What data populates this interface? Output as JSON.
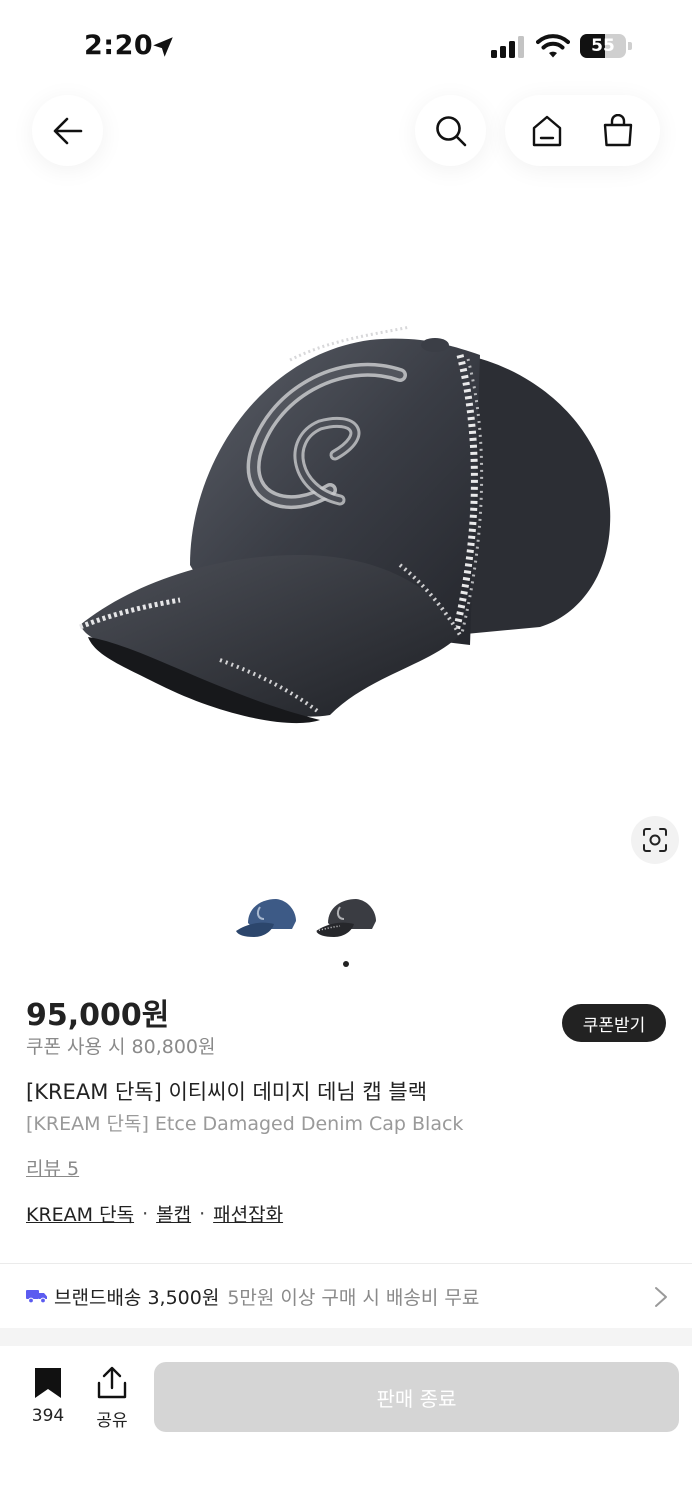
{
  "status_bar": {
    "time": "2:20",
    "battery_level": 55,
    "battery_text": "55"
  },
  "product": {
    "price": "95,000원",
    "coupon_price_text": "쿠폰 사용 시 80,800원",
    "coupon_button_label": "쿠폰받기",
    "title_ko": "[KREAM 단독] 이티씨이 데미지 데님 캡 블랙",
    "title_en": "[KREAM 단독] Etce Damaged Denim Cap Black",
    "review_link": "리뷰 5",
    "tags": [
      "KREAM 단독",
      "볼캡",
      "패션잡화"
    ],
    "tag_separator": "·",
    "thumbnails": [
      "blue-denim-cap-thumbnail",
      "black-denim-cap-thumbnail"
    ],
    "active_thumbnail_index": 1
  },
  "shipping": {
    "label": "브랜드배송 3,500원",
    "note": "5만원 이상 구매 시 배송비 무료"
  },
  "bottom_bar": {
    "bookmark_count": "394",
    "share_label": "공유",
    "action_button_label": "판매 종료"
  },
  "icons": {
    "back": "arrow-left-icon",
    "search": "search-icon",
    "home": "home-icon",
    "cart": "shopping-bag-icon",
    "lens": "visual-search-icon",
    "truck": "truck-icon",
    "bookmark": "bookmark-icon",
    "share": "share-icon"
  },
  "colors": {
    "primary_text": "#222222",
    "secondary_text": "#8a8a8a",
    "shipping_icon": "#5b5bf0",
    "disabled_button": "#d5d5d5"
  }
}
